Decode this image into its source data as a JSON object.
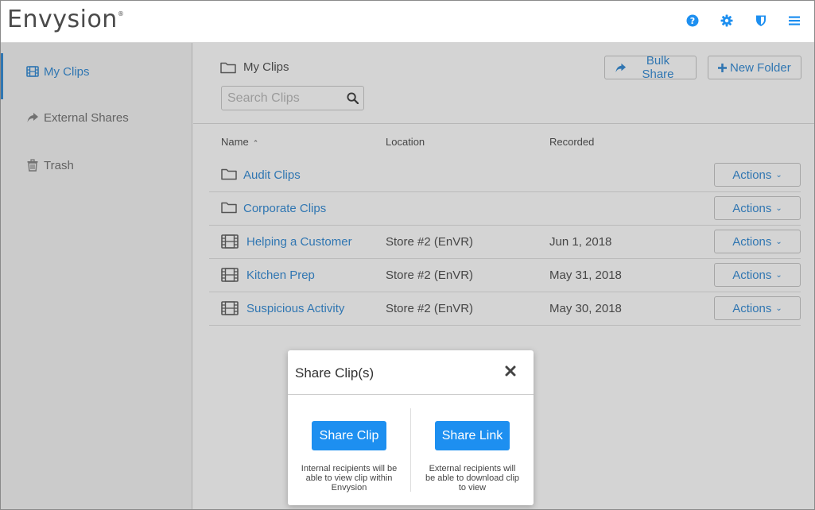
{
  "header": {
    "logo_text": "Envysion",
    "logo_mark": "®",
    "icons": [
      "help-icon",
      "gear-icon",
      "shield-icon",
      "menu-icon"
    ],
    "accent": "#1d8ff0"
  },
  "sidebar": {
    "items": [
      {
        "label": "My Clips",
        "icon": "film-icon",
        "active": true
      },
      {
        "label": "External Shares",
        "icon": "share-icon",
        "active": false
      },
      {
        "label": "Trash",
        "icon": "trash-icon",
        "active": false
      }
    ]
  },
  "main": {
    "breadcrumb": "My Clips",
    "bulk_share_label": "Bulk Share",
    "new_folder_label": "New Folder",
    "search": {
      "placeholder": "Search Clips",
      "value": ""
    },
    "columns": {
      "name": "Name",
      "location": "Location",
      "recorded": "Recorded"
    },
    "rows": [
      {
        "type": "folder",
        "name": "Audit Clips",
        "location": "",
        "recorded": "",
        "actions": "Actions"
      },
      {
        "type": "folder",
        "name": "Corporate Clips",
        "location": "",
        "recorded": "",
        "actions": "Actions"
      },
      {
        "type": "clip",
        "name": "Helping a Customer",
        "location": "Store #2 (EnVR)",
        "recorded": "Jun 1, 2018",
        "actions": "Actions"
      },
      {
        "type": "clip",
        "name": "Kitchen Prep",
        "location": "Store #2 (EnVR)",
        "recorded": "May 31, 2018",
        "actions": "Actions"
      },
      {
        "type": "clip",
        "name": "Suspicious Activity",
        "location": "Store #2 (EnVR)",
        "recorded": "May 30, 2018",
        "actions": "Actions"
      }
    ]
  },
  "modal": {
    "title": "Share Clip(s)",
    "share_clip_label": "Share Clip",
    "share_clip_help": "Internal recipients will be able to view clip within Envysion",
    "share_link_label": "Share Link",
    "share_link_help": "External recipients will be able to download clip to view"
  }
}
